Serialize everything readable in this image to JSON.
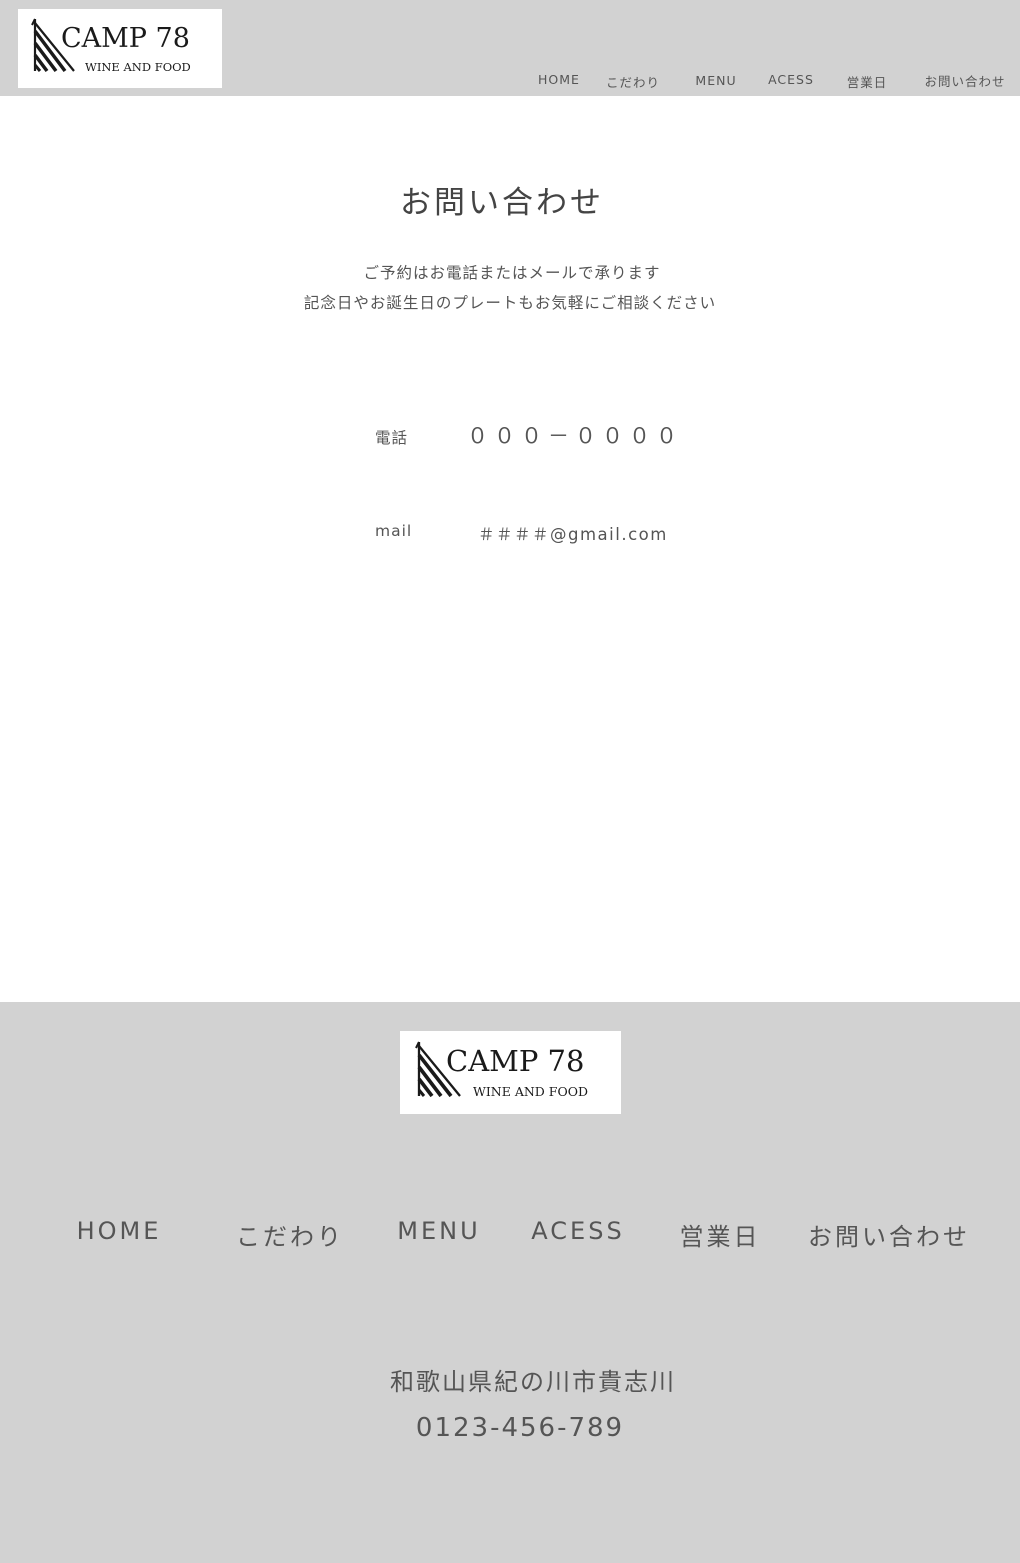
{
  "brand": {
    "logo_title": "CAMP 78",
    "logo_subtitle": "WINE AND FOOD"
  },
  "nav": {
    "items": [
      {
        "label": "HOME"
      },
      {
        "label": "こだわり"
      },
      {
        "label": "MENU"
      },
      {
        "label": "ACESS"
      },
      {
        "label": "営業日"
      },
      {
        "label": "お問い合わせ"
      }
    ]
  },
  "contact": {
    "title": "お問い合わせ",
    "intro_line1": "ご予約はお電話またはメールで承ります",
    "intro_line2": "記念日やお誕生日のプレートもお気軽にご相談ください",
    "phone_label": "電話",
    "phone_value": "０００－００００",
    "mail_label": "mail",
    "mail_value": "＃＃＃＃@gmail.com"
  },
  "footer": {
    "address": "和歌山県紀の川市貴志川",
    "phone": "0123-456-789"
  },
  "colors": {
    "header_bg": "#d2d2d2",
    "footer_bg": "#d2d2d2",
    "text": "#555555"
  }
}
